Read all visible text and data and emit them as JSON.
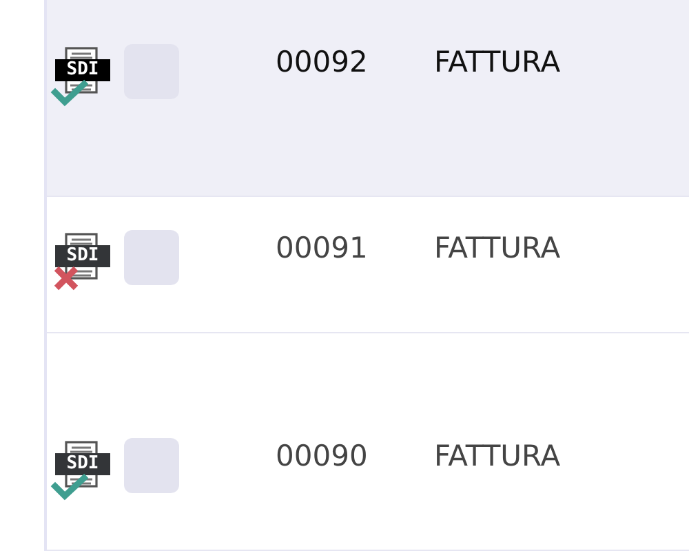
{
  "invoices": [
    {
      "badge": "SDI",
      "kind": "accepted",
      "checked": false,
      "selected": true,
      "number": "00092",
      "type": "FATTURA"
    },
    {
      "badge": "SDI",
      "kind": "rejected",
      "checked": false,
      "selected": false,
      "number": "00091",
      "type": "FATTURA"
    },
    {
      "badge": "SDI",
      "kind": "accepted",
      "checked": false,
      "selected": false,
      "number": "00090",
      "type": "FATTURA"
    }
  ]
}
